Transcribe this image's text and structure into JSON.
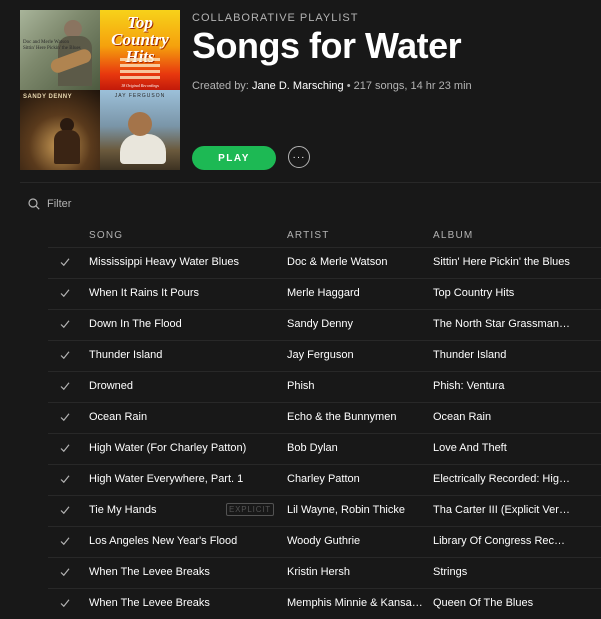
{
  "playlist": {
    "eyebrow": "COLLABORATIVE PLAYLIST",
    "title": "Songs for Water",
    "created_by_label": "Created by:",
    "creator": "Jane D. Marsching",
    "stats": " • 217 songs, 14 hr 23 min",
    "play_label": "PLAY",
    "more_label": "···",
    "cover_texts": {
      "c1": "Doc and Merle Watson\nSittin' Here Pickin' the Blues",
      "c2": "Top Country Hits",
      "c2_foot": "18 Original Recordings",
      "c3": "SANDY DENNY",
      "c4": "JAY FERGUSON"
    }
  },
  "filter": {
    "placeholder": "Filter"
  },
  "columns": {
    "song": "SONG",
    "artist": "ARTIST",
    "album": "ALBUM"
  },
  "colors": {
    "accent": "#1db954",
    "background": "#181818",
    "muted": "#b3b3b3"
  },
  "tracks": [
    {
      "song": "Mississippi Heavy Water Blues",
      "artist": "Doc & Merle Watson",
      "album": "Sittin' Here Pickin' the Blues"
    },
    {
      "song": "When It Rains It Pours",
      "artist": "Merle Haggard",
      "album": "Top Country Hits"
    },
    {
      "song": "Down In The Flood",
      "artist": "Sandy Denny",
      "album": "The North Star Grassman And The Ravens"
    },
    {
      "song": "Thunder Island",
      "artist": "Jay Ferguson",
      "album": "Thunder Island"
    },
    {
      "song": "Drowned",
      "artist": "Phish",
      "album": "Phish: Ventura"
    },
    {
      "song": "Ocean Rain",
      "artist": "Echo & the Bunnymen",
      "album": "Ocean Rain"
    },
    {
      "song": "High Water (For Charley Patton)",
      "artist": "Bob Dylan",
      "album": "Love And Theft"
    },
    {
      "song": "High Water Everywhere, Part. 1",
      "artist": "Charley Patton",
      "album": "Electrically Recorded: High Water Everywhere"
    },
    {
      "song": "Tie My Hands",
      "explicit": "EXPLICIT",
      "artist": "Lil Wayne, Robin Thicke",
      "album": "Tha Carter III (Explicit Version)"
    },
    {
      "song": "Los Angeles New Year's Flood",
      "artist": "Woody Guthrie",
      "album": "Library Of Congress Recordings"
    },
    {
      "song": "When The Levee Breaks",
      "artist": "Kristin Hersh",
      "album": "Strings"
    },
    {
      "song": "When The Levee Breaks",
      "artist": "Memphis Minnie & Kansas Joe McCoy",
      "album": "Queen Of The Blues"
    }
  ]
}
